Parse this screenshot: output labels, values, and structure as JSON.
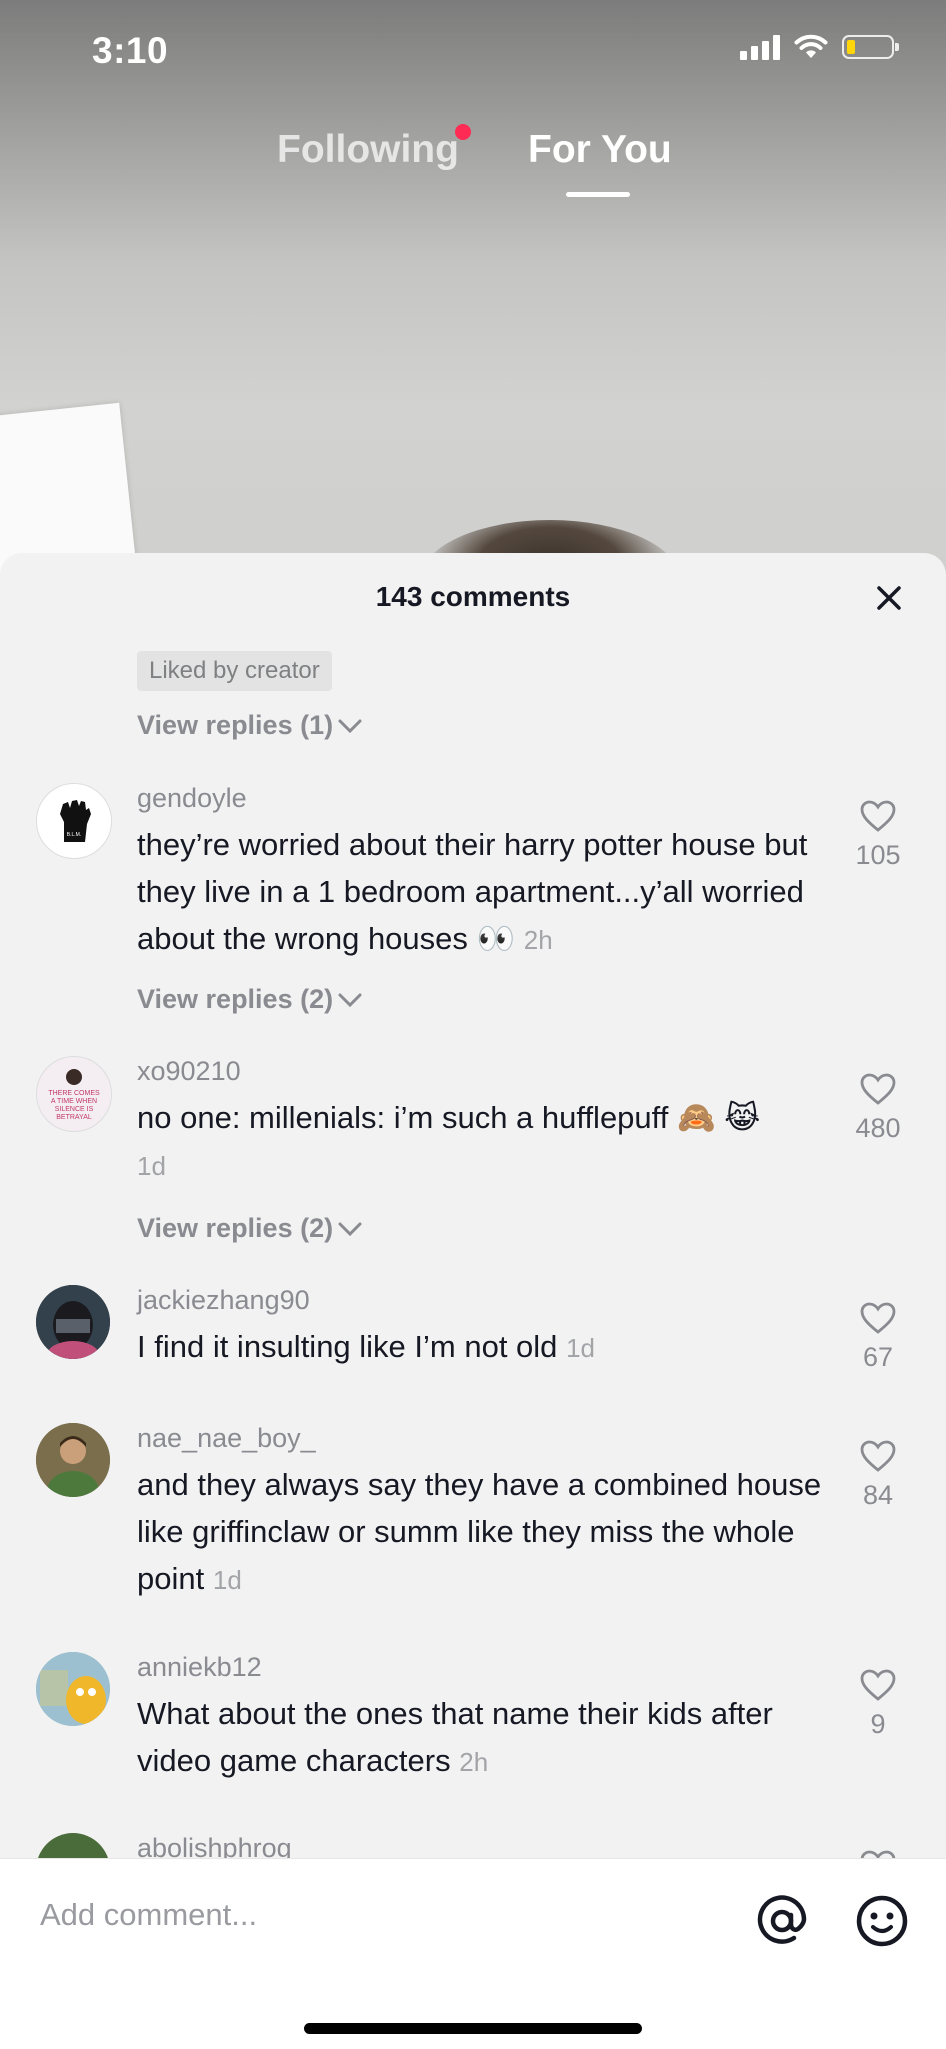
{
  "status_bar": {
    "time": "3:10"
  },
  "top_tabs": {
    "following": "Following",
    "for_you": "For You"
  },
  "comments_sheet": {
    "title": "143 comments",
    "liked_by_creator": "Liked by creator",
    "first_view_replies": "View replies (1)",
    "comments": [
      {
        "username": "gendoyle",
        "text": "they’re worried about their harry potter house but they live in a 1 bedroom apartment...y’all worried about the wrong houses",
        "emoji": "👀",
        "time": "2h",
        "likes": "105",
        "replies": "View replies (2)"
      },
      {
        "username": "xo90210",
        "text": "no one: millenials: i’m such a hufflepuff",
        "emoji": "🙈 😹",
        "time": "1d",
        "likes": "480",
        "replies": "View replies (2)"
      },
      {
        "username": "jackiezhang90",
        "text": "I find it insulting like I’m not old",
        "time": "1d",
        "likes": "67"
      },
      {
        "username": "nae_nae_boy_",
        "text": "and they always say they have a combined house like griffinclaw or summ like they miss the whole point",
        "time": "1d",
        "likes": "84"
      },
      {
        "username": "anniekb12",
        "text": "What about the ones that name their kids after video game characters",
        "time": "2h",
        "likes": "9"
      },
      {
        "username": "abolishphrog"
      }
    ]
  },
  "bottom_bar": {
    "placeholder": "Add comment..."
  },
  "colors": {
    "accent_dot": "#fe2c55",
    "sheet_bg": "#f2f2f2",
    "text_primary": "#161823",
    "text_secondary": "#8a8b91"
  }
}
